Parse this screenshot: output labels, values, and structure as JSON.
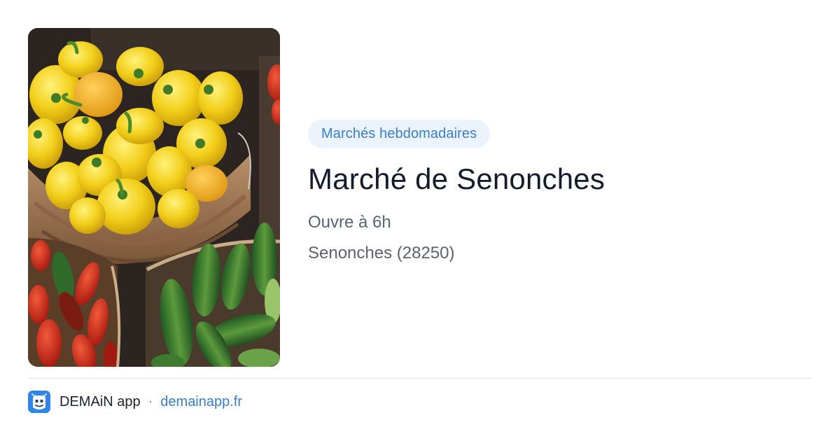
{
  "card": {
    "image_description_name": "market-photo",
    "category_tag": "Marchés hebdomadaires",
    "title": "Marché de Senonches",
    "opening": "Ouvre à 6h",
    "location": "Senonches (28250)"
  },
  "footer": {
    "app_name": "DEMAiN app",
    "separator": "·",
    "domain": "demainapp.fr"
  },
  "colors": {
    "tag_background": "#ebf3fc",
    "tag_text": "#3a7dc9",
    "title": "#141b2d",
    "meta": "#5a6274",
    "link": "#3a7dc9",
    "app_icon": "#2f86e8"
  }
}
